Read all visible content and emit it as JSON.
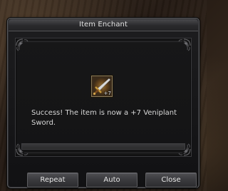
{
  "window": {
    "title": "Item Enchant"
  },
  "item": {
    "icon": "sword-icon",
    "enchant_badge": "+7"
  },
  "result": {
    "message": "Success! The item is now a +7 Veniplant Sword."
  },
  "progress": {
    "fraction": 1.0
  },
  "buttons": {
    "repeat": "Repeat",
    "auto": "Auto",
    "close": "Close"
  },
  "colors": {
    "panel": "#161617",
    "border": "#5b5b5e",
    "text": "#d8d8d8",
    "icon_frame": "#8a7a5a"
  }
}
